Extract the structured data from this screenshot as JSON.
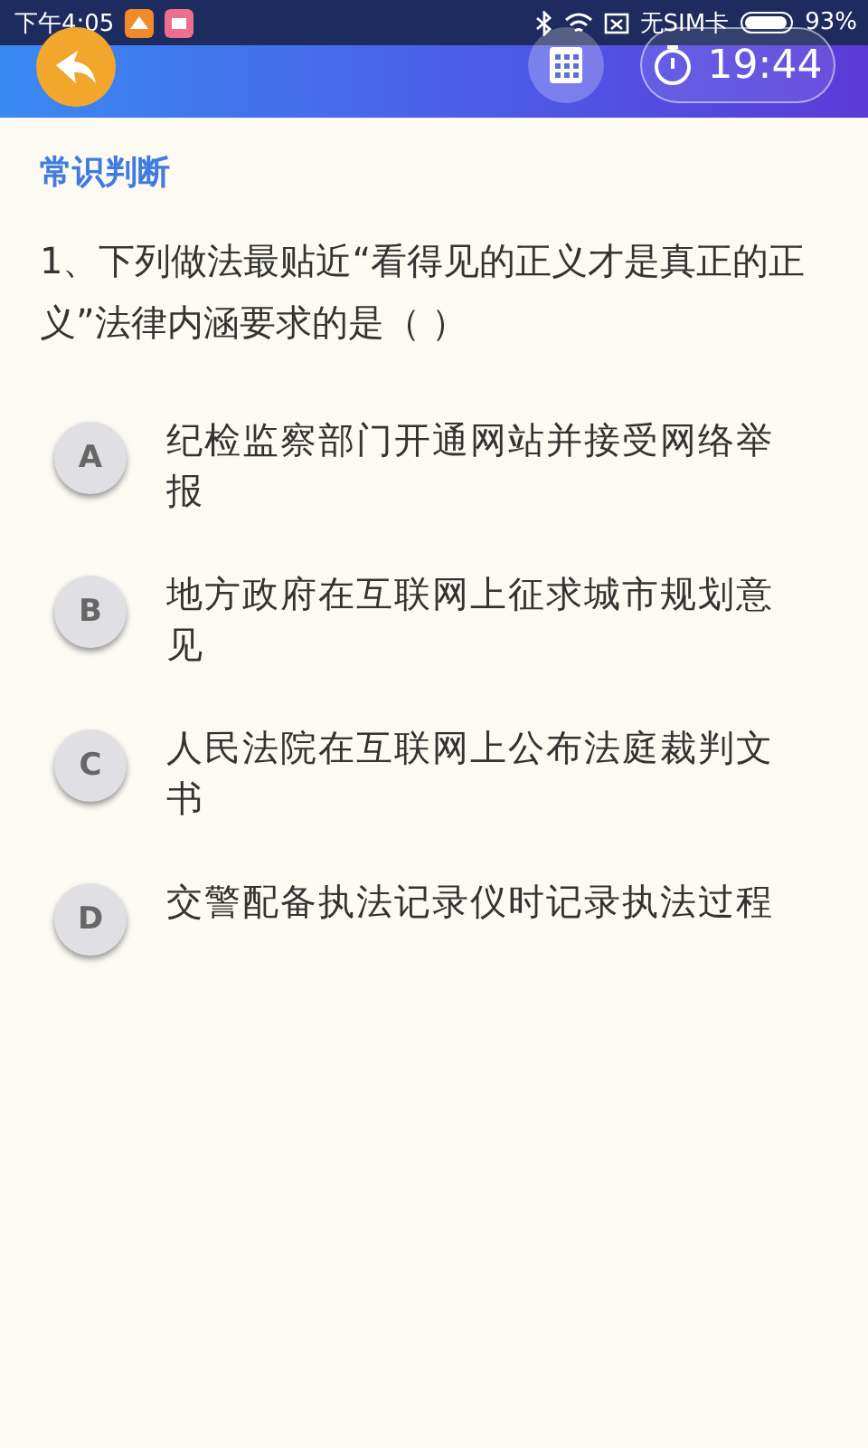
{
  "status_bar": {
    "time": "下午4:05",
    "carrier": "无SIM卡",
    "battery": "93%"
  },
  "header": {
    "timer": "19:44"
  },
  "section": "常识判断",
  "question": "1、下列做法最贴近“看得见的正义才是真正的正义”法律内涵要求的是（  ）",
  "options": [
    {
      "letter": "A",
      "text": "纪检监察部门开通网站并接受网络举报",
      "selected": false
    },
    {
      "letter": "B",
      "text": "地方政府在互联网上征求城市规划意见",
      "selected": false
    },
    {
      "letter": "C",
      "text": "人民法院在互联网上公布法庭裁判文书",
      "selected": false
    },
    {
      "letter": "D",
      "text": "交警配备执法记录仪时记录执法过程",
      "selected": false
    }
  ]
}
